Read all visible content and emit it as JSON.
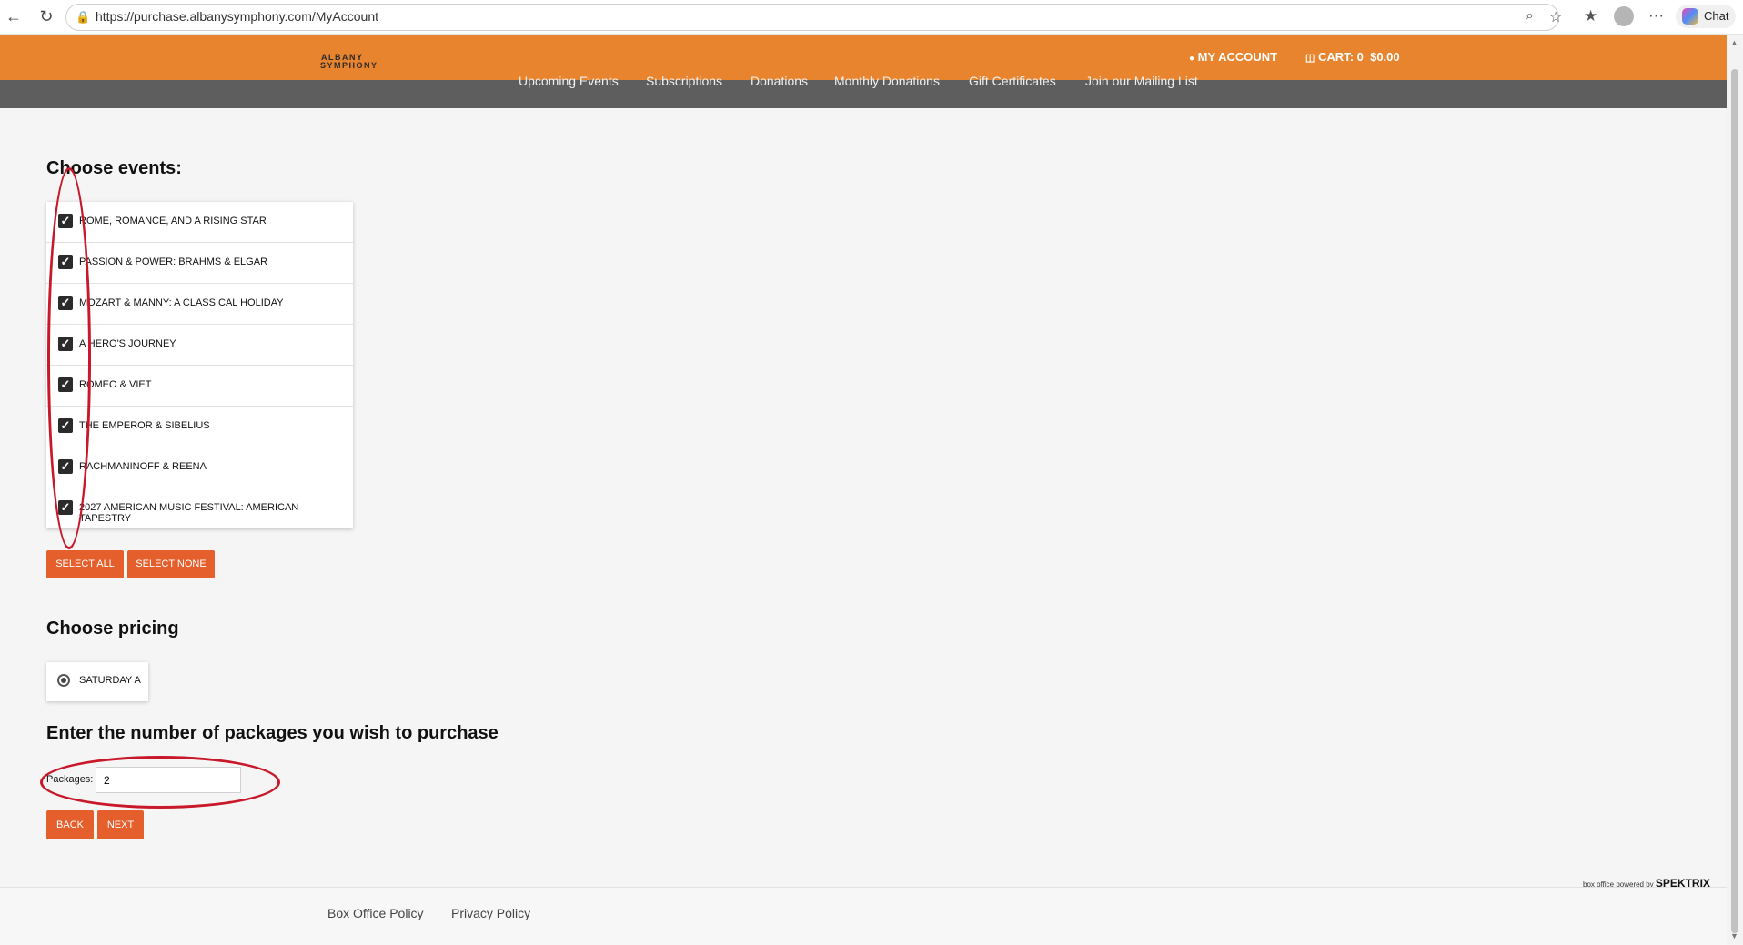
{
  "browser": {
    "url": "https://purchase.albanysymphony.com/MyAccount",
    "chat_label": "Chat"
  },
  "header": {
    "brand_line1": "ALBANY",
    "brand_line2": "SYMPHONY",
    "my_account": "MY ACCOUNT",
    "cart": "CART: 0  $0.00"
  },
  "nav": [
    "Upcoming Events",
    "Subscriptions",
    "Donations",
    "Monthly Donations",
    "Gift Certificates",
    "Join our Mailing List"
  ],
  "events_section": {
    "title": "Choose events:",
    "events": [
      {
        "label": "ROME, ROMANCE, AND A RISING STAR",
        "checked": true
      },
      {
        "label": "PASSION & POWER: BRAHMS & ELGAR",
        "checked": true
      },
      {
        "label": "MOZART & MANNY: A CLASSICAL HOLIDAY",
        "checked": true
      },
      {
        "label": "A HERO'S JOURNEY",
        "checked": true
      },
      {
        "label": "ROMEO & VIET",
        "checked": true
      },
      {
        "label": "THE EMPEROR & SIBELIUS",
        "checked": true
      },
      {
        "label": "RACHMANINOFF & REENA",
        "checked": true
      },
      {
        "label": "2027 AMERICAN MUSIC FESTIVAL: AMERICAN TAPESTRY",
        "checked": true
      }
    ],
    "select_all": "SELECT ALL",
    "select_none": "SELECT NONE"
  },
  "pricing_section": {
    "title": "Choose pricing",
    "option": "SATURDAY A",
    "selected": true
  },
  "packages_section": {
    "title": "Enter the number of packages you wish to purchase",
    "label": "Packages:",
    "value": "2",
    "back": "BACK",
    "next": "NEXT"
  },
  "powered_by": {
    "prefix": "box office powered by",
    "brand": "SPEKTRIX"
  },
  "footer": {
    "box_office_policy": "Box Office Policy",
    "privacy_policy": "Privacy Policy"
  },
  "colors": {
    "header": "#e8842e",
    "button": "#e45f2b",
    "nav_bar": "#5e5e5e",
    "annotation": "#c8182a"
  }
}
